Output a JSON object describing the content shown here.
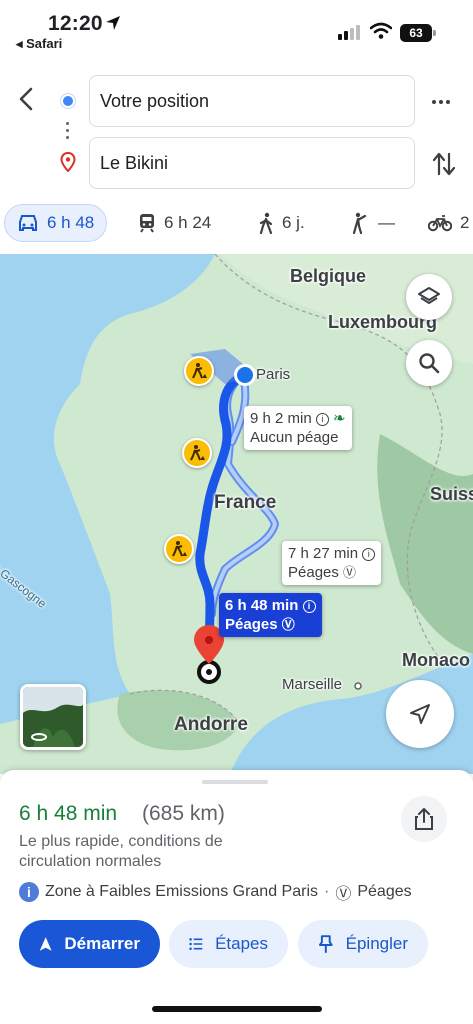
{
  "status_bar": {
    "time": "12:20",
    "back_app": "◂ Safari",
    "battery": "63"
  },
  "search": {
    "origin": "Votre position",
    "destination": "Le Bikini"
  },
  "modes": [
    {
      "label": "6 h 48",
      "icon": "car-icon",
      "active": true
    },
    {
      "label": "6 h 24",
      "icon": "train-icon"
    },
    {
      "label": "6 j.",
      "icon": "walk-icon"
    },
    {
      "label": "—",
      "icon": "rideshare-icon"
    },
    {
      "label": "2",
      "icon": "bike-icon"
    }
  ],
  "map": {
    "labels": {
      "belgique": "Belgique",
      "luxembourg": "Luxembourg",
      "paris": "Paris",
      "france": "France",
      "suisse": "Suiss",
      "gascogne": "e Gascogne",
      "monaco": "Monaco",
      "marseille": "Marseille",
      "andorre": "Andorre"
    },
    "routes": {
      "alt1": {
        "time": "9 h 2 min",
        "sub": "Aucun péage"
      },
      "alt2": {
        "time": "7 h 27 min",
        "sub": "Péages"
      },
      "selected": {
        "time": "6 h 48 min",
        "sub": "Péages"
      }
    },
    "colors": {
      "route": "#1a57e8",
      "alt_route": "#8fb0f5",
      "water": "#9fd3f0",
      "land": "#cde8cf"
    }
  },
  "summary": {
    "duration": "6 h 48 min",
    "distance": "(685 km)",
    "description": "Le plus rapide, conditions de circulation normales",
    "zone": "Zone à Faibles Emissions Grand Paris",
    "separator": "·",
    "tolls": "Péages"
  },
  "actions": {
    "start": "Démarrer",
    "steps": "Étapes",
    "pin": "Épingler"
  }
}
